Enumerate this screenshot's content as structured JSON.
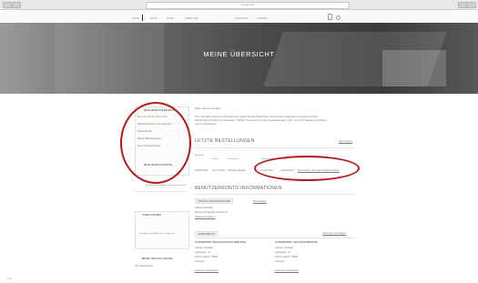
{
  "browser": {
    "address": "n1.ereich.de"
  },
  "nav": {
    "items": [
      "SHOP",
      "BLOG",
      "GARN",
      "ÜBER UNS",
      "VERSAND",
      "FRAGEN"
    ]
  },
  "hero": {
    "title": "MEINE ÜBERSICHT"
  },
  "sidebar": {
    "my_account_title": "MEIN BENUTZERKONTO",
    "links": [
      "Benutzerkonto Übersicht",
      "Benutzerkonto Informationen",
      "Adressbuch",
      "Meine Bestellungen",
      "Mein Wunschzettel"
    ],
    "wishlist_title": "MEIN WUNSCHZETTEL",
    "wishlist_empty": "Sie haben keine Artikel auf dem Wunschzettel.",
    "compare_title": "VERGLEICHEN",
    "compare_empty": "Sie haben keine Artikel zum Vergleichen.",
    "orders_title": "MEINE BESTELLUNGEN",
    "orders_link": "Zum Warenkorb"
  },
  "main": {
    "greeting": "Hallo, Fabrice Schaller!",
    "intro_line1": "Von Ihrer Benutzerkonto-Übersicht aus haben Sie die Möglichkeit, Ihre letzten Vorgänge einzusehen und Ihre",
    "intro_line2": "Benutzerkonto-Daten zu bearbeiten. Wählen Sie dazu einen der untenstehenden Links, um Informationen anzusehen",
    "intro_line3": "oder zu bearbeiten.",
    "recent_orders_title": "LETZTE BESTELLUNGEN",
    "view_all": "Alle zeigen",
    "orders_headers": [
      "Bestellung",
      "Datum",
      "Lieferung an",
      "Gesamtsumme",
      "Status"
    ],
    "orders_row": [
      "100000106",
      "03.12.2014",
      "Fabrice Schaller",
      "21,00 CHF",
      "Ausstehend",
      "Bestellung anzeigen",
      "Nachbestellen"
    ],
    "account_info_title": "BENUTZERKONTO INFORMATIONEN",
    "contact_title": "KONTAKTINFORMATIONEN",
    "edit": "Bearbeiten",
    "contact_lines": [
      "Fabrice Schaller",
      "fabrice.schaller@example.ch",
      "Passwort ändern"
    ],
    "address_book": "ADRESSBUCH",
    "manage_addresses": "Adressen verwalten",
    "billing_title": "STANDARD RECHNUNGSADRESSE",
    "shipping_title": "STANDARD LIEFERADRESSE",
    "billing_lines": [
      "Fabrice Schaller",
      "Seefeldstr. 73",
      "Zürich, Zürich, 8008",
      "Schweiz"
    ],
    "shipping_lines": [
      "Fabrice Schaller",
      "Seefeldstr. 73",
      "Zürich, Zürich, 8008",
      "Schweiz"
    ],
    "billing_edit": "Adresse bearbeiten",
    "shipping_edit": "Adresse bearbeiten"
  },
  "footer": {
    "copyright": "© 2014"
  }
}
